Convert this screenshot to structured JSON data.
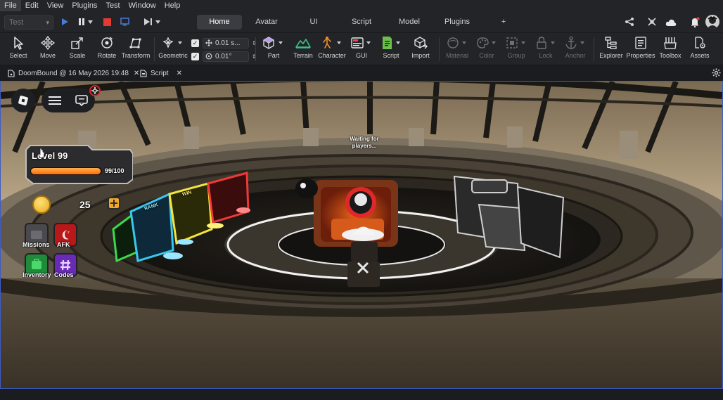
{
  "menu": [
    "File",
    "Edit",
    "View",
    "Plugins",
    "Test",
    "Window",
    "Help"
  ],
  "topbar": {
    "test_select": "Test",
    "tabs": [
      "Home",
      "Avatar",
      "UI",
      "Script",
      "Model",
      "Plugins"
    ],
    "add_tab": "+"
  },
  "ribbon": {
    "select": "Select",
    "move": "Move",
    "scale": "Scale",
    "rotate": "Rotate",
    "transform": "Transform",
    "geometric": "Geometric",
    "move_snap": "0.01 s...",
    "rotate_snap": "0.01°",
    "part": "Part",
    "terrain": "Terrain",
    "character": "Character",
    "gui": "GUI",
    "script": "Script",
    "import": "Import",
    "material": "Material",
    "color": "Color",
    "group": "Group",
    "lock": "Lock",
    "anchor": "Anchor",
    "explorer": "Explorer",
    "properties": "Properties",
    "toolbox": "Toolbox",
    "assets": "Assets"
  },
  "doctabs": {
    "place": "DoomBound @ 16 May 2026 19:48",
    "script": "Script"
  },
  "game": {
    "level_label": "Level 99",
    "xp": "99/100",
    "xp_fraction": 0.99,
    "coins": "25",
    "status": "Waiting for players...",
    "missions": "Missions",
    "afk": "AFK",
    "inventory": "Inventory",
    "codes": "Codes",
    "arcade_1": "RANK",
    "arcade_2": "WIN"
  },
  "colors": {
    "accent": "#3d5cc8",
    "record_stop": "#e53935",
    "play": "#4a7bd8",
    "xp_bar": "#ff7a1a"
  }
}
